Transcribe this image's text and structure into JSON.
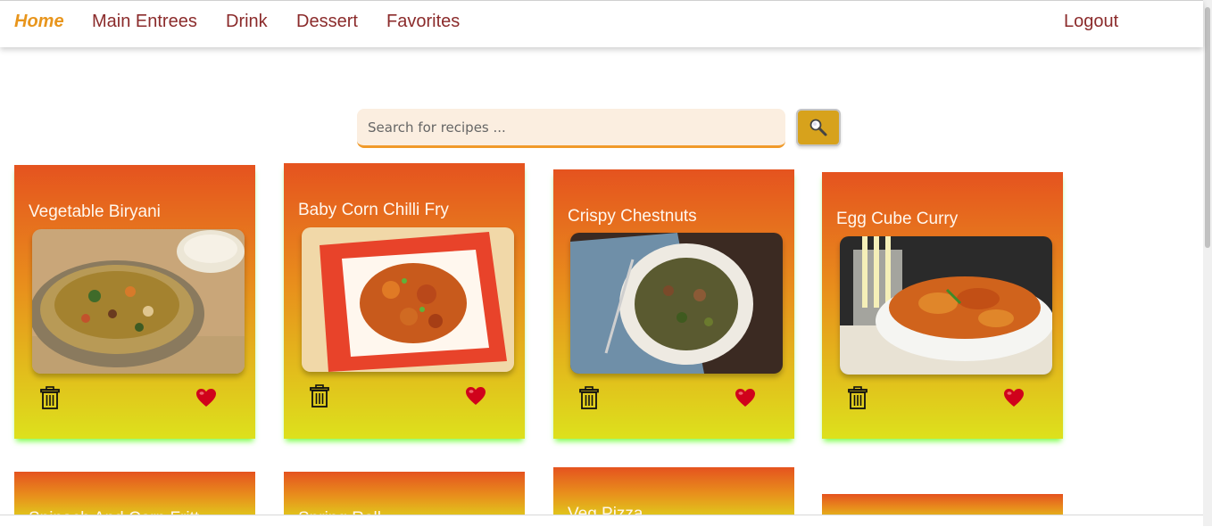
{
  "nav": {
    "home": "Home",
    "main_entrees": "Main Entrees",
    "drink": "Drink",
    "dessert": "Dessert",
    "favorites": "Favorites",
    "logout": "Logout"
  },
  "search": {
    "placeholder": "Search for recipes ...",
    "value": ""
  },
  "icons": {
    "search": "search-icon",
    "delete": "trash-icon",
    "favorite": "heart-icon"
  },
  "colors": {
    "brand_link": "#8b2b2b",
    "active_link": "#e8951c",
    "card_gradient_top": "#e5531f",
    "card_gradient_bottom": "#dde11c",
    "heart": "#d0021b"
  },
  "recipes": [
    {
      "title": "Vegetable Biryani"
    },
    {
      "title": "Baby Corn Chilli Fry"
    },
    {
      "title": "Crispy Chestnuts"
    },
    {
      "title": "Egg Cube Curry"
    },
    {
      "title": "Spinach And Corn Fritt"
    },
    {
      "title": "Spring Roll"
    },
    {
      "title": "Veg Pizza"
    },
    {
      "title": ""
    }
  ]
}
